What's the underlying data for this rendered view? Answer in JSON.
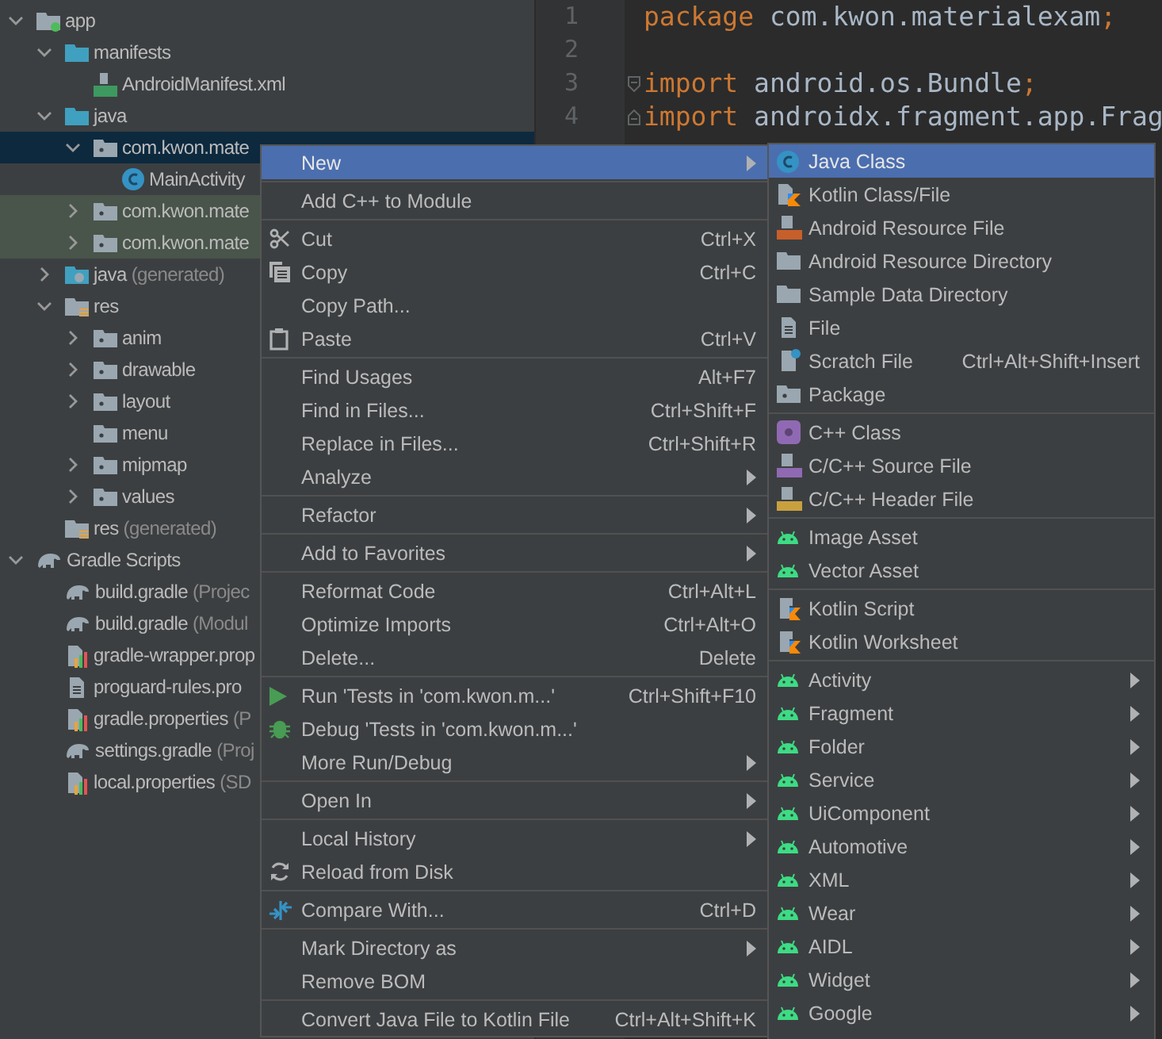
{
  "project_tree": {
    "items": [
      {
        "label": "app",
        "kind": "module",
        "expanded": true,
        "selected": false,
        "children": [
          {
            "label": "manifests",
            "kind": "source-folder",
            "expanded": true,
            "selected": false,
            "children": [
              {
                "label": "AndroidManifest.xml",
                "kind": "manifest",
                "selected": false
              }
            ]
          },
          {
            "label": "java",
            "kind": "source-folder",
            "expanded": true,
            "selected": false,
            "children": [
              {
                "label": "com.kwon.mate",
                "kind": "package",
                "expanded": true,
                "selected": true,
                "children": [
                  {
                    "label": "MainActivity",
                    "kind": "class",
                    "selected": false
                  }
                ]
              },
              {
                "label": "com.kwon.mate",
                "kind": "package",
                "expanded": false,
                "selected": false,
                "test": true
              },
              {
                "label": "com.kwon.mate",
                "kind": "package",
                "expanded": false,
                "selected": false,
                "test": true
              }
            ]
          },
          {
            "label": "java",
            "hint": "(generated)",
            "kind": "generated-folder",
            "expanded": false,
            "selected": false
          },
          {
            "label": "res",
            "kind": "res-folder",
            "expanded": true,
            "selected": false,
            "children": [
              {
                "label": "anim",
                "kind": "package",
                "expanded": false,
                "selected": false
              },
              {
                "label": "drawable",
                "kind": "package",
                "expanded": false,
                "selected": false
              },
              {
                "label": "layout",
                "kind": "package",
                "expanded": false,
                "selected": false
              },
              {
                "label": "menu",
                "kind": "package",
                "selected": false
              },
              {
                "label": "mipmap",
                "kind": "package",
                "expanded": false,
                "selected": false
              },
              {
                "label": "values",
                "kind": "package",
                "expanded": false,
                "selected": false
              }
            ]
          },
          {
            "label": "res",
            "hint": "(generated)",
            "kind": "res-folder",
            "selected": false
          }
        ]
      },
      {
        "label": "Gradle Scripts",
        "kind": "gradle",
        "expanded": true,
        "selected": false,
        "children": [
          {
            "label": "build.gradle",
            "hint": "(Projec",
            "kind": "gradle",
            "selected": false
          },
          {
            "label": "build.gradle",
            "hint": "(Modul",
            "kind": "gradle",
            "selected": false
          },
          {
            "label": "gradle-wrapper.prop",
            "kind": "properties",
            "selected": false
          },
          {
            "label": "proguard-rules.pro",
            "kind": "file",
            "selected": false
          },
          {
            "label": "gradle.properties",
            "hint": "(P",
            "kind": "properties",
            "selected": false
          },
          {
            "label": "settings.gradle",
            "hint": "(Proj",
            "kind": "gradle",
            "selected": false
          },
          {
            "label": "local.properties",
            "hint": "(SD",
            "kind": "properties",
            "selected": false
          }
        ]
      }
    ]
  },
  "editor": {
    "lines": [
      {
        "number": "1",
        "tokens": [
          {
            "text": "package",
            "kind": "keyword"
          },
          {
            "text": " com.kwon.materialexam",
            "kind": "plain"
          },
          {
            "text": ";",
            "kind": "keyword"
          }
        ]
      },
      {
        "number": "2"
      },
      {
        "number": "3",
        "kind": "fold-start",
        "tokens": [
          {
            "text": "import",
            "kind": "keyword"
          },
          {
            "text": " android.os.Bundle",
            "kind": "plain"
          },
          {
            "text": ";",
            "kind": "keyword"
          }
        ]
      },
      {
        "number": "4",
        "kind": "fold-end",
        "tokens": [
          {
            "text": "import",
            "kind": "keyword"
          },
          {
            "text": " androidx.fragment.app.Frag",
            "kind": "plain"
          }
        ]
      }
    ]
  },
  "context_menu": {
    "groups": [
      {
        "items": [
          {
            "label": "New",
            "submenu": true,
            "selected": true
          }
        ]
      },
      {
        "items": [
          {
            "label": "Add C++ to Module",
            "selected": false
          }
        ]
      },
      {
        "items": [
          {
            "label": "Cut",
            "kind": "cut",
            "shortcut": "Ctrl+X",
            "selected": false
          },
          {
            "label": "Copy",
            "kind": "copy",
            "shortcut": "Ctrl+C",
            "selected": false
          },
          {
            "label": "Copy Path...",
            "selected": false
          },
          {
            "label": "Paste",
            "kind": "paste",
            "shortcut": "Ctrl+V",
            "selected": false
          }
        ]
      },
      {
        "items": [
          {
            "label": "Find Usages",
            "shortcut": "Alt+F7",
            "selected": false
          },
          {
            "label": "Find in Files...",
            "shortcut": "Ctrl+Shift+F",
            "selected": false
          },
          {
            "label": "Replace in Files...",
            "shortcut": "Ctrl+Shift+R",
            "selected": false
          },
          {
            "label": "Analyze",
            "submenu": true,
            "selected": false
          }
        ]
      },
      {
        "items": [
          {
            "label": "Refactor",
            "submenu": true,
            "selected": false
          }
        ]
      },
      {
        "items": [
          {
            "label": "Add to Favorites",
            "submenu": true,
            "selected": false
          }
        ]
      },
      {
        "items": [
          {
            "label": "Reformat Code",
            "shortcut": "Ctrl+Alt+L",
            "selected": false
          },
          {
            "label": "Optimize Imports",
            "shortcut": "Ctrl+Alt+O",
            "selected": false
          },
          {
            "label": "Delete...",
            "shortcut": "Delete",
            "selected": false
          }
        ]
      },
      {
        "items": [
          {
            "label": "Run 'Tests in 'com.kwon.m...'",
            "kind": "run",
            "shortcut": "Ctrl+Shift+F10",
            "selected": false
          },
          {
            "label": "Debug 'Tests in 'com.kwon.m...'",
            "kind": "debug",
            "selected": false
          },
          {
            "label": "More Run/Debug",
            "submenu": true,
            "selected": false
          }
        ]
      },
      {
        "items": [
          {
            "label": "Open In",
            "submenu": true,
            "selected": false
          }
        ]
      },
      {
        "items": [
          {
            "label": "Local History",
            "submenu": true,
            "selected": false
          },
          {
            "label": "Reload from Disk",
            "kind": "reload",
            "selected": false
          }
        ]
      },
      {
        "items": [
          {
            "label": "Compare With...",
            "kind": "compare",
            "shortcut": "Ctrl+D",
            "selected": false
          }
        ]
      },
      {
        "items": [
          {
            "label": "Mark Directory as",
            "submenu": true,
            "selected": false
          },
          {
            "label": "Remove BOM",
            "selected": false
          }
        ]
      },
      {
        "items": [
          {
            "label": "Convert Java File to Kotlin File",
            "shortcut": "Ctrl+Alt+Shift+K",
            "selected": false
          }
        ]
      }
    ]
  },
  "new_submenu": {
    "groups": [
      {
        "items": [
          {
            "label": "Java Class",
            "kind": "java-class",
            "selected": true
          },
          {
            "label": "Kotlin Class/File",
            "kind": "kotlin",
            "selected": false
          },
          {
            "label": "Android Resource File",
            "kind": "resource-file",
            "selected": false
          },
          {
            "label": "Android Resource Directory",
            "kind": "folder",
            "selected": false
          },
          {
            "label": "Sample Data Directory",
            "kind": "folder",
            "selected": false
          },
          {
            "label": "File",
            "kind": "file",
            "selected": false
          },
          {
            "label": "Scratch File",
            "kind": "scratch",
            "shortcut": "Ctrl+Alt+Shift+Insert",
            "selected": false
          },
          {
            "label": "Package",
            "kind": "package",
            "selected": false
          }
        ]
      },
      {
        "items": [
          {
            "label": "C++ Class",
            "kind": "cpp-class",
            "selected": false
          },
          {
            "label": "C/C++ Source File",
            "kind": "cpp-source",
            "selected": false
          },
          {
            "label": "C/C++ Header File",
            "kind": "cpp-header",
            "selected": false
          }
        ]
      },
      {
        "items": [
          {
            "label": "Image Asset",
            "kind": "android",
            "selected": false
          },
          {
            "label": "Vector Asset",
            "kind": "android",
            "selected": false
          }
        ]
      },
      {
        "items": [
          {
            "label": "Kotlin Script",
            "kind": "kotlin-script",
            "selected": false
          },
          {
            "label": "Kotlin Worksheet",
            "kind": "kotlin-script",
            "selected": false
          }
        ]
      },
      {
        "items": [
          {
            "label": "Activity",
            "kind": "android",
            "submenu": true,
            "selected": false
          },
          {
            "label": "Fragment",
            "kind": "android",
            "submenu": true,
            "selected": false
          },
          {
            "label": "Folder",
            "kind": "android",
            "submenu": true,
            "selected": false
          },
          {
            "label": "Service",
            "kind": "android",
            "submenu": true,
            "selected": false
          },
          {
            "label": "UiComponent",
            "kind": "android",
            "submenu": true,
            "selected": false
          },
          {
            "label": "Automotive",
            "kind": "android",
            "submenu": true,
            "selected": false
          },
          {
            "label": "XML",
            "kind": "android",
            "submenu": true,
            "selected": false
          },
          {
            "label": "Wear",
            "kind": "android",
            "submenu": true,
            "selected": false
          },
          {
            "label": "AIDL",
            "kind": "android",
            "submenu": true,
            "selected": false
          },
          {
            "label": "Widget",
            "kind": "android",
            "submenu": true,
            "selected": false
          },
          {
            "label": "Google",
            "kind": "android",
            "submenu": true,
            "selected": false
          }
        ]
      }
    ]
  }
}
